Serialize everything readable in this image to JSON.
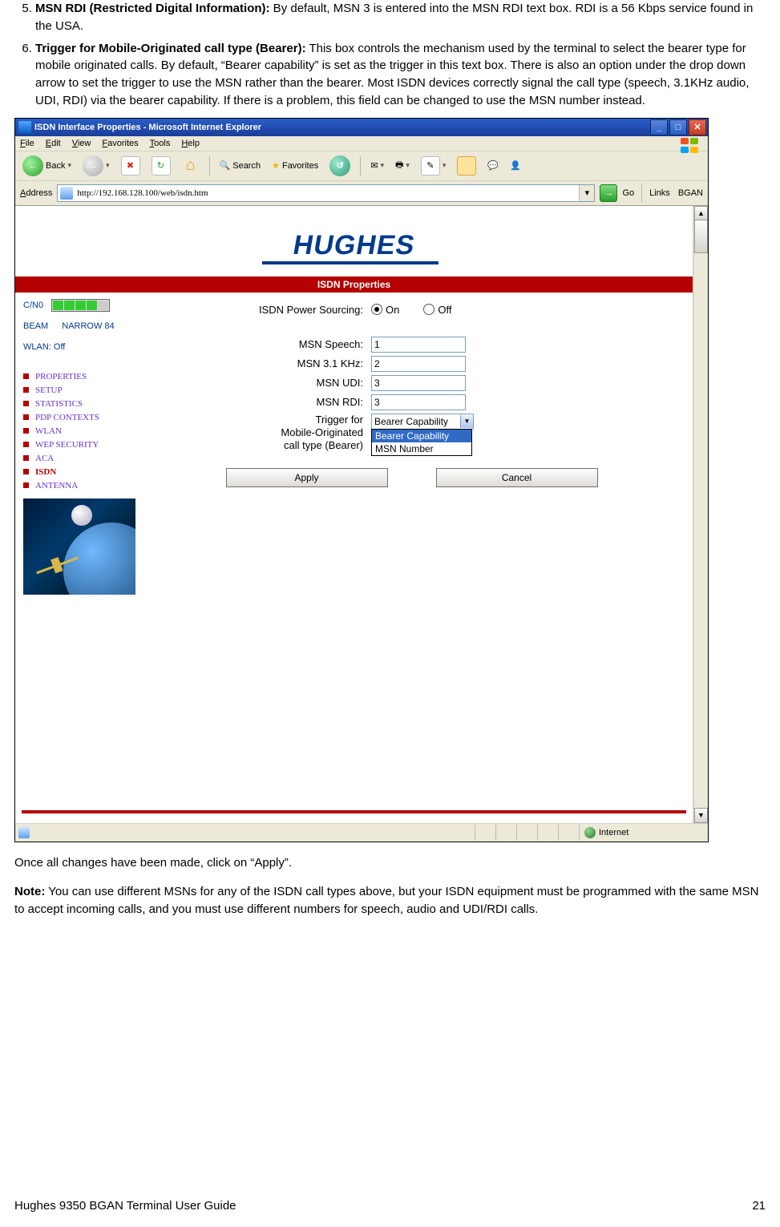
{
  "list": {
    "item5": {
      "lead": "MSN RDI (Restricted Digital Information):",
      "rest": " By default, MSN 3 is entered into the MSN RDI text box.  RDI is a 56 Kbps service found in the USA."
    },
    "item6": {
      "lead": "Trigger for Mobile-Originated call type (Bearer):",
      "rest": "  This box controls the mechanism used by the terminal to select the bearer type for mobile originated calls. By default, “Bearer capability” is set as the trigger in this text box.  There is also an option under the drop down arrow to set the trigger to use the MSN rather than the bearer. Most ISDN devices correctly signal the call type (speech, 3.1KHz audio, UDI, RDI) via the bearer capability. If there is a problem, this field can be changed to use the MSN number instead."
    }
  },
  "ie": {
    "title": "ISDN Interface Properties - Microsoft Internet Explorer",
    "menu": [
      "File",
      "Edit",
      "View",
      "Favorites",
      "Tools",
      "Help"
    ],
    "toolbar": {
      "back": "Back",
      "search": "Search",
      "favorites": "Favorites"
    },
    "addr_label": "Address",
    "url": "http://192.168.128.100/web/isdn.htm",
    "go": "Go",
    "links": "Links",
    "link1": "BGAN",
    "status_zone": "Internet"
  },
  "web": {
    "logo": "HUGHES",
    "banner": "ISDN Properties",
    "cno": "C/N0",
    "beam_label": "BEAM",
    "beam_value": "NARROW 84",
    "wlan": "WLAN: Off",
    "nav": [
      {
        "label": "PROPERTIES",
        "active": false
      },
      {
        "label": "SETUP",
        "active": false
      },
      {
        "label": "STATISTICS",
        "active": false
      },
      {
        "label": "PDP CONTEXTS",
        "active": false
      },
      {
        "label": "WLAN",
        "active": false
      },
      {
        "label": "WEP SECURITY",
        "active": false
      },
      {
        "label": "ACA",
        "active": false
      },
      {
        "label": "ISDN",
        "active": true
      },
      {
        "label": "ANTENNA",
        "active": false
      }
    ],
    "form": {
      "power": "ISDN Power Sourcing:",
      "on": "On",
      "off": "Off",
      "speech_lbl": "MSN Speech:",
      "speech_val": "1",
      "khz_lbl": "MSN 3.1 KHz:",
      "khz_val": "2",
      "udi_lbl": "MSN UDI:",
      "udi_val": "3",
      "rdi_lbl": "MSN RDI:",
      "rdi_val": "3",
      "trig_lbl1": "Trigger for",
      "trig_lbl2": "Mobile-Originated",
      "trig_lbl3": "call type (Bearer)",
      "sel_val": "Bearer Capability",
      "opt1": "Bearer Capability",
      "opt2": "MSN Number",
      "apply": "Apply",
      "cancel": "Cancel"
    }
  },
  "after": {
    "p1": "Once all changes have been made, click on “Apply”.",
    "note_lead": "Note:",
    "note": " You can use different MSNs for any of the ISDN call types above, but your ISDN equipment must be programmed with the same MSN to accept incoming calls, and you must use different numbers for speech, audio and UDI/RDI calls."
  },
  "footer": {
    "left": "Hughes 9350 BGAN Terminal User Guide",
    "right": "21"
  }
}
